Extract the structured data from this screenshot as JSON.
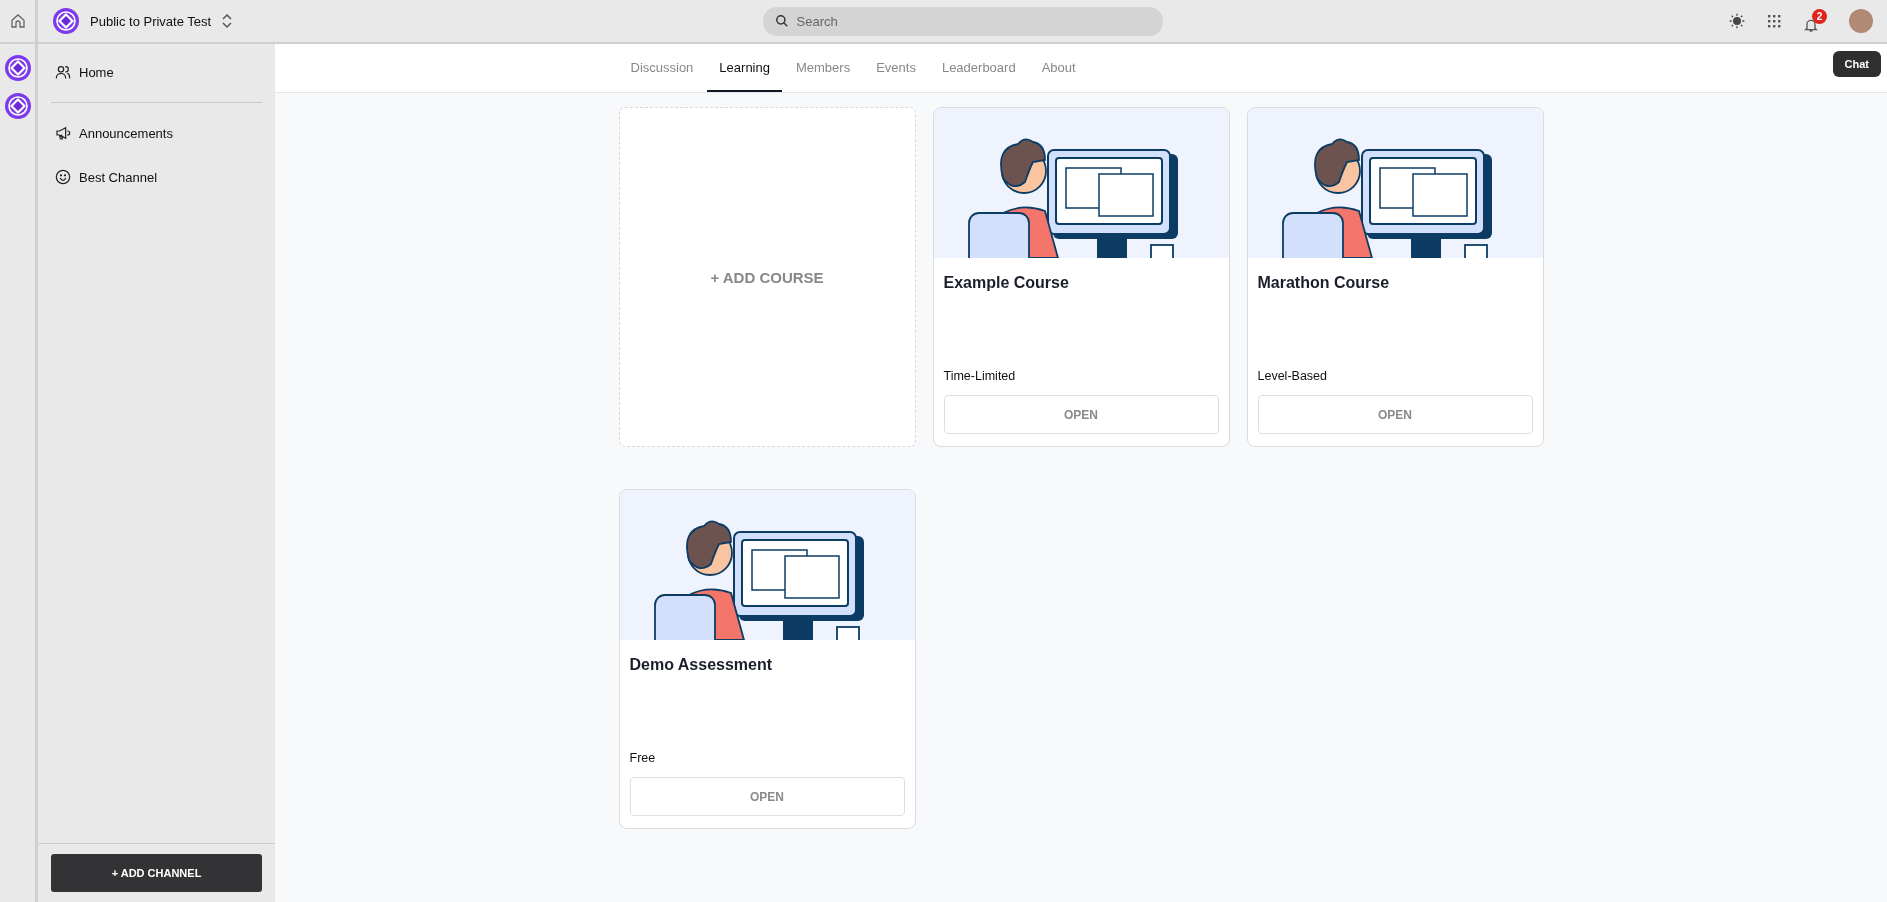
{
  "topbar": {
    "community": "Public to Private Test",
    "search": {
      "placeholder": "Search"
    },
    "notifications": "2"
  },
  "sidebar": {
    "items": [
      {
        "label": "Home"
      },
      {
        "label": "Announcements"
      },
      {
        "label": "Best Channel"
      }
    ],
    "add_button": "+ ADD CHANNEL"
  },
  "tabs": [
    {
      "label": "Discussion",
      "selected": false
    },
    {
      "label": "Learning",
      "selected": true
    },
    {
      "label": "Members",
      "selected": false
    },
    {
      "label": "Events",
      "selected": false
    },
    {
      "label": "Leaderboard",
      "selected": false
    },
    {
      "label": "About",
      "selected": false
    }
  ],
  "chat_button": "Chat",
  "add_course": "+ ADD COURSE",
  "courses": [
    {
      "title": "Example Course",
      "type": "Time-Limited",
      "button": "OPEN"
    },
    {
      "title": "Marathon Course",
      "type": "Level-Based",
      "button": "OPEN"
    },
    {
      "title": "Demo Assessment",
      "type": "Free",
      "button": "OPEN"
    }
  ]
}
